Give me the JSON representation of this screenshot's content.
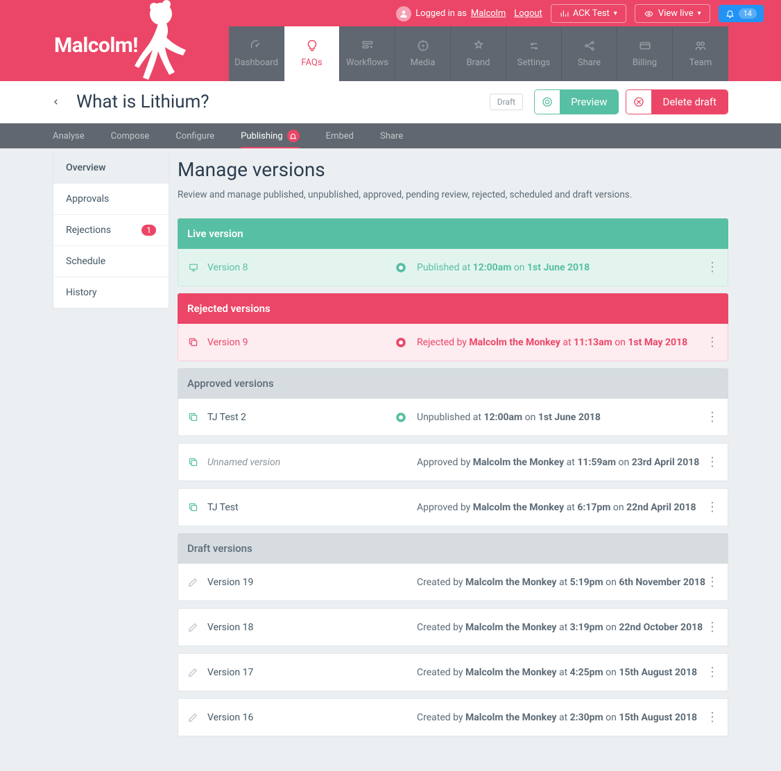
{
  "topbar": {
    "loggedInPrefix": "Logged in as",
    "username": "Malcolm",
    "logout": "Logout",
    "ackTest": "ACK Test",
    "viewLive": "View live",
    "notifCount": "14"
  },
  "brand": "Malcolm!",
  "mainnav": [
    {
      "label": "Dashboard"
    },
    {
      "label": "FAQs"
    },
    {
      "label": "Workflows"
    },
    {
      "label": "Media"
    },
    {
      "label": "Brand"
    },
    {
      "label": "Settings"
    },
    {
      "label": "Share"
    },
    {
      "label": "Billing"
    },
    {
      "label": "Team"
    }
  ],
  "titlebar": {
    "title": "What is Lithium?",
    "draft": "Draft",
    "preview": "Preview",
    "delete": "Delete draft"
  },
  "subnav": [
    {
      "label": "Analyse"
    },
    {
      "label": "Compose"
    },
    {
      "label": "Configure"
    },
    {
      "label": "Publishing"
    },
    {
      "label": "Embed"
    },
    {
      "label": "Share"
    }
  ],
  "sidemenu": [
    {
      "label": "Overview"
    },
    {
      "label": "Approvals"
    },
    {
      "label": "Rejections",
      "count": "1"
    },
    {
      "label": "Schedule"
    },
    {
      "label": "History"
    }
  ],
  "page": {
    "heading": "Manage versions",
    "subtitle": "Review and manage published, unpublished, approved, pending review, rejected, scheduled and draft versions."
  },
  "sections": {
    "live": {
      "header": "Live version",
      "rows": [
        {
          "name": "Version 8",
          "prefix": "Published at ",
          "time": "12:00am",
          "on": " on ",
          "date": "1st June 2018"
        }
      ]
    },
    "rejected": {
      "header": "Rejected versions",
      "rows": [
        {
          "name": "Version 9",
          "prefix": "Rejected by ",
          "by": "Malcolm the Monkey",
          "at": " at ",
          "time": "11:13am",
          "on": " on ",
          "date": "1st May 2018"
        }
      ]
    },
    "approved": {
      "header": "Approved versions",
      "rows": [
        {
          "name": "TJ Test 2",
          "prefix": "Unpublished at ",
          "time": "12:00am",
          "on": " on ",
          "date": "1st June 2018",
          "hasMid": true
        },
        {
          "name": "Unnamed version",
          "italic": true,
          "prefix": "Approved by ",
          "by": "Malcolm the Monkey",
          "at": " at ",
          "time": "11:59am",
          "on": " on ",
          "date": "23rd April 2018"
        },
        {
          "name": "TJ Test",
          "prefix": "Approved by ",
          "by": "Malcolm the Monkey",
          "at": " at ",
          "time": "6:17pm",
          "on": " on ",
          "date": "22nd April 2018"
        }
      ]
    },
    "draft": {
      "header": "Draft versions",
      "rows": [
        {
          "name": "Version 19",
          "prefix": "Created by ",
          "by": "Malcolm the Monkey",
          "at": " at ",
          "time": "5:19pm",
          "on": " on ",
          "date": "6th November 2018"
        },
        {
          "name": "Version 18",
          "prefix": "Created by ",
          "by": "Malcolm the Monkey",
          "at": " at ",
          "time": "3:19pm",
          "on": " on ",
          "date": "22nd October 2018"
        },
        {
          "name": "Version 17",
          "prefix": "Created by ",
          "by": "Malcolm the Monkey",
          "at": " at ",
          "time": "4:25pm",
          "on": " on ",
          "date": "15th August 2018"
        },
        {
          "name": "Version 16",
          "prefix": "Created by ",
          "by": "Malcolm the Monkey",
          "at": " at ",
          "time": "2:30pm",
          "on": " on ",
          "date": "15th August 2018"
        }
      ]
    }
  }
}
